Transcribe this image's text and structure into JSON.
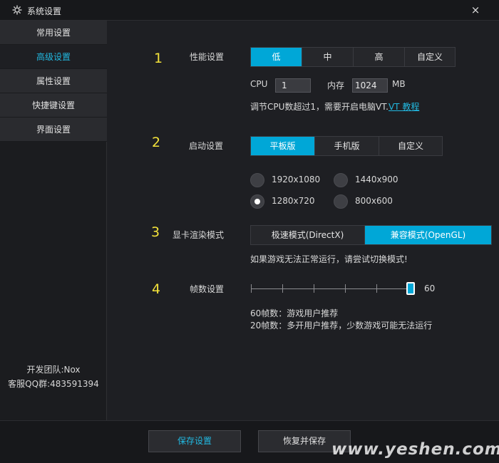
{
  "window": {
    "title": "系统设置",
    "close_label": "×"
  },
  "sidebar": {
    "items": [
      {
        "label": "常用设置",
        "active": false
      },
      {
        "label": "高级设置",
        "active": true
      },
      {
        "label": "属性设置",
        "active": false
      },
      {
        "label": "快捷键设置",
        "active": false
      },
      {
        "label": "界面设置",
        "active": false
      }
    ],
    "footer": {
      "team": "开发团队:Nox",
      "qq": "客服QQ群:483591394"
    }
  },
  "performance": {
    "number": "1",
    "label": "性能设置",
    "options": [
      "低",
      "中",
      "高",
      "自定义"
    ],
    "selected": "低",
    "cpu_label": "CPU",
    "cpu_value": "1",
    "memory_label": "内存",
    "memory_value": "1024",
    "memory_unit": "MB",
    "hint_text": "调节CPU数超过1，需要开启电脑VT.",
    "hint_link": "VT 教程"
  },
  "startup": {
    "number": "2",
    "label": "启动设置",
    "options": [
      "平板版",
      "手机版",
      "自定义"
    ],
    "selected": "平板版",
    "resolutions": [
      "1920x1080",
      "1440x900",
      "1280x720",
      "800x600"
    ],
    "selected_resolution": "1280x720"
  },
  "render": {
    "number": "3",
    "label": "显卡渲染模式",
    "options": [
      "极速模式(DirectX)",
      "兼容模式(OpenGL)"
    ],
    "selected": "兼容模式(OpenGL)",
    "hint": "如果游戏无法正常运行，请尝试切换模式!"
  },
  "fps": {
    "number": "4",
    "label": "帧数设置",
    "value": "60",
    "slider_fraction": 1.0,
    "note1": "60帧数：游戏用户推荐",
    "note2": "20帧数：多开用户推荐，少数游戏可能无法运行"
  },
  "buttons": {
    "save": "保存设置",
    "restore": "恢复并保存"
  },
  "watermark": "www.yeshen.com",
  "colors": {
    "accent": "#00a7d7",
    "number": "#f3e23a",
    "link": "#22b8e0"
  }
}
